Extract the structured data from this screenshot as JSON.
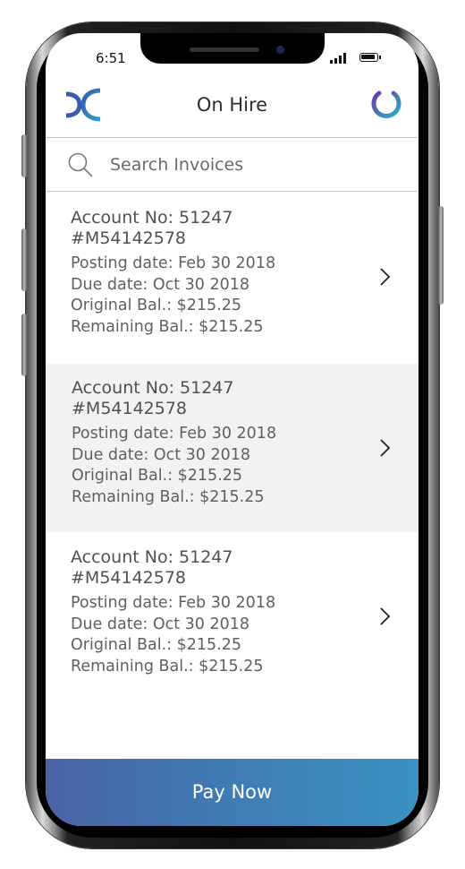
{
  "status_bar": {
    "time": "6:51"
  },
  "header": {
    "title": "On Hire",
    "logo_icon": "logo-icon",
    "power_icon": "power-icon"
  },
  "search": {
    "placeholder": "Search Invoices",
    "value": ""
  },
  "invoices": [
    {
      "account": "Account No: 51247",
      "number": "#M54142578",
      "posting": "Posting date: Feb 30 2018",
      "due": "Due date: Oct 30 2018",
      "original": "Original Bal.: $215.25",
      "remaining": "Remaining Bal.: $215.25"
    },
    {
      "account": "Account No: 51247",
      "number": "#M54142578",
      "posting": "Posting date: Feb 30 2018",
      "due": "Due date: Oct 30 2018",
      "original": "Original Bal.: $215.25",
      "remaining": "Remaining Bal.: $215.25"
    },
    {
      "account": "Account No: 51247",
      "number": "#M54142578",
      "posting": "Posting date: Feb 30 2018",
      "due": "Due date: Oct 30 2018",
      "original": "Original Bal.: $215.25",
      "remaining": "Remaining Bal.: $215.25"
    }
  ],
  "footer": {
    "pay_label": "Pay Now"
  },
  "colors": {
    "accent_start": "#4a63a6",
    "accent_end": "#3a92c3",
    "alt_row": "#f2f2f2"
  }
}
